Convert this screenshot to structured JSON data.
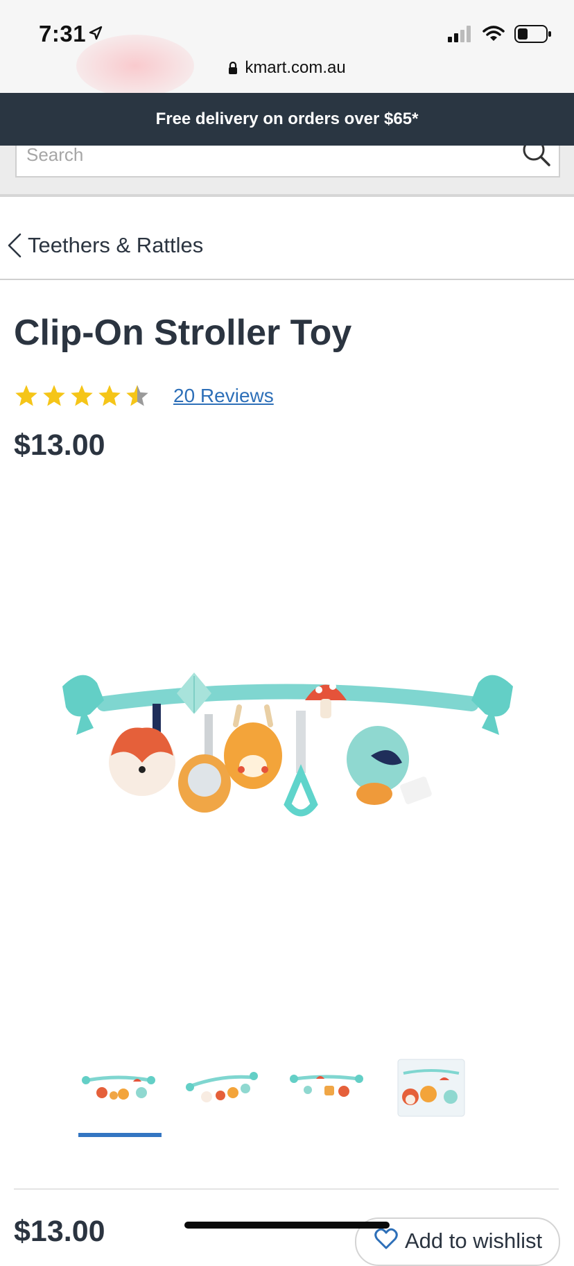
{
  "status_bar": {
    "time": "7:31",
    "url": "kmart.com.au"
  },
  "banner": {
    "text": "Free delivery on orders over $65*"
  },
  "search": {
    "placeholder": "Search"
  },
  "breadcrumb": {
    "label": "Teethers & Rattles"
  },
  "product": {
    "title": "Clip-On Stroller Toy",
    "rating": 4.5,
    "rating_max": 5,
    "reviews_label": "20 Reviews",
    "price": "$13.00"
  },
  "gallery": {
    "thumbnails": [
      "thumbnail-1",
      "thumbnail-2",
      "thumbnail-3",
      "thumbnail-4"
    ],
    "active_index": 0
  },
  "sticky_bar": {
    "price": "$13.00",
    "wishlist_label": "Add to wishlist"
  },
  "colors": {
    "banner": "#2a3642",
    "link": "#2d6fb8",
    "star": "#f5c518",
    "active_thumb": "#3476c2"
  }
}
